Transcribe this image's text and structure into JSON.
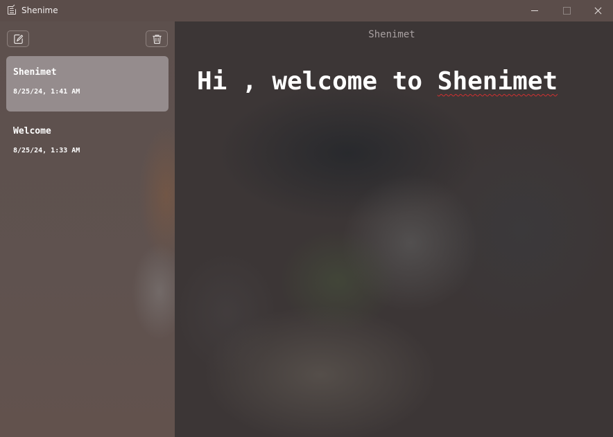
{
  "window": {
    "title": "Shenime"
  },
  "sidebar": {
    "toolbar": {
      "new_note_icon": "edit-note-icon",
      "delete_icon": "trash-icon"
    },
    "notes": [
      {
        "title": "Shenimet",
        "date": "8/25/24, 1:41 AM",
        "selected": true
      },
      {
        "title": "Welcome",
        "date": "8/25/24, 1:33 AM",
        "selected": false
      }
    ]
  },
  "editor": {
    "document_title": "Shenimet",
    "content_prefix": "Hi , welcome to ",
    "content_misspelled": "Shenimet"
  },
  "colors": {
    "selected_item_bg": "#958c8d",
    "spellcheck_underline": "#d23030"
  }
}
